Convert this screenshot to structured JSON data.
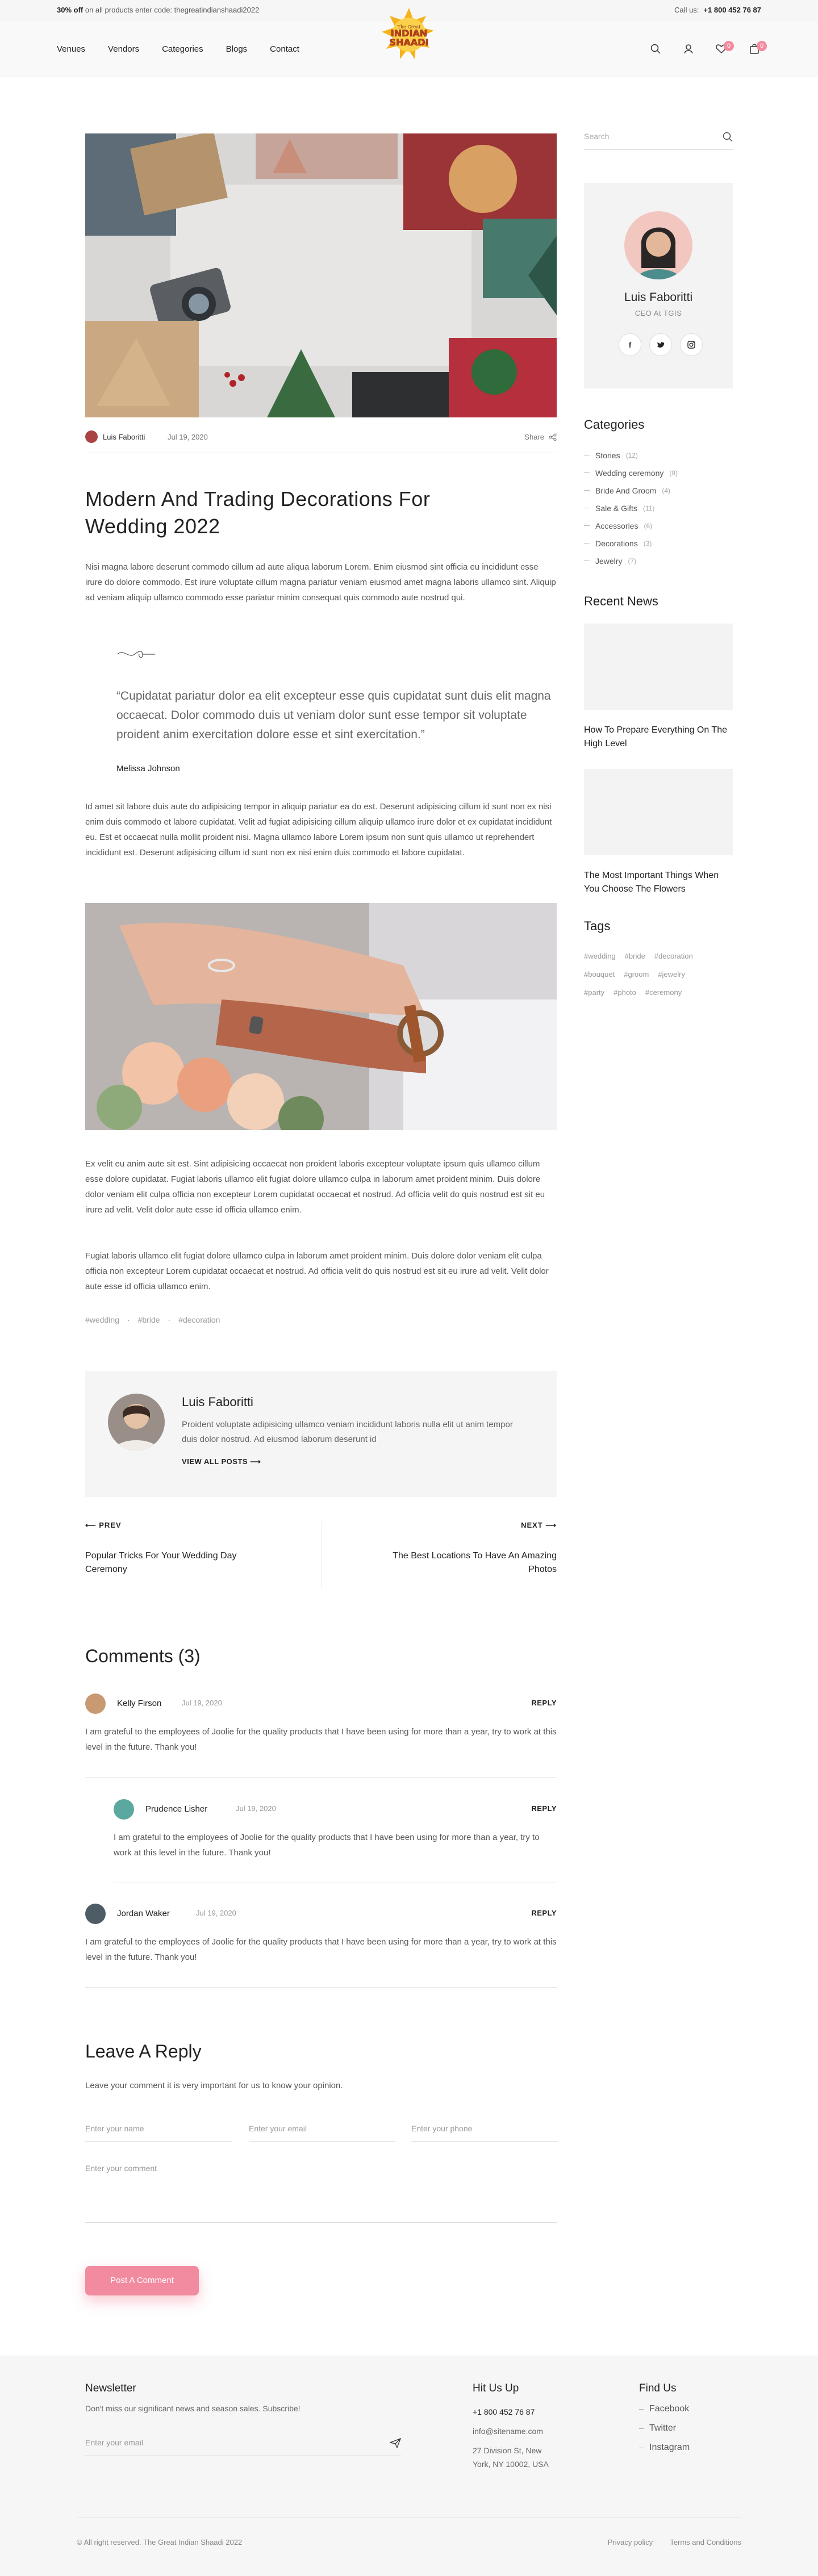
{
  "topbar": {
    "promo_bold": "30% off",
    "promo_text": "on all products enter code: thegreatindianshaadi2022",
    "call_label": "Call us:",
    "phone": "+1 800 452 76 87"
  },
  "logo": {
    "line1": "INDIAN",
    "line2": "SHAADI",
    "line3": "The Great"
  },
  "nav": [
    "Venues",
    "Vendors",
    "Categories",
    "Blogs",
    "Contact"
  ],
  "header_icons": {
    "wishlist_count": "0",
    "cart_count": "0"
  },
  "post": {
    "author": "Luis Faboritti",
    "date": "Jul 19, 2020",
    "share_label": "Share",
    "title": "Modern And Trading Decorations For Wedding 2022",
    "intro": "Nisi magna labore deserunt commodo cillum ad aute aliqua laborum Lorem. Enim eiusmod sint officia eu incididunt esse irure do dolore commodo. Est irure voluptate cillum magna pariatur veniam eiusmod amet magna laboris ullamco sint. Aliquip ad veniam aliquip ullamco commodo esse pariatur minim consequat quis commodo aute nostrud qui.",
    "quote": "“Cupidatat pariatur dolor ea elit excepteur esse quis cupidatat sunt duis elit magna occaecat. Dolor commodo duis ut veniam dolor sunt esse tempor sit voluptate  proident anim exercitation dolore esse et sint exercitation.”",
    "quote_author": "Melissa  Johnson",
    "para2": "Id amet sit labore duis aute do adipisicing tempor in aliquip pariatur ea do est. Deserunt adipisicing cillum id sunt non ex nisi enim duis commodo et labore cupidatat. Velit ad fugiat adipisicing cillum aliquip ullamco irure dolor et ex cupidatat incididunt eu. Est et occaecat nulla mollit proident nisi. Magna ullamco labore Lorem ipsum non sunt quis ullamco ut reprehendert incididunt est. Deserunt adipisicing cillum id sunt non ex nisi enim duis commodo et labore cupidatat.",
    "para3": "Ex velit eu anim aute sit est. Sint adipisicing occaecat non proident laboris excepteur voluptate ipsum quis ullamco cillum esse dolore cupidatat. Fugiat laboris ullamco elit fugiat dolore ullamco culpa in laborum amet proident minim. Duis dolore dolor veniam elit culpa officia non excepteur Lorem cupidatat occaecat et nostrud. Ad officia velit do quis nostrud est sit eu irure ad velit. Velit dolor aute esse id officia ullamco enim.",
    "para4": "Fugiat laboris ullamco elit fugiat dolore ullamco culpa in laborum amet proident minim. Duis dolore dolor veniam elit culpa officia non excepteur Lorem cupidatat occaecat et nostrud. Ad officia velit do quis nostrud est sit eu irure ad velit. Velit dolor aute esse id officia ullamco enim.",
    "tags": [
      "#wedding",
      "·",
      "#bride",
      "·",
      "#decoration"
    ]
  },
  "author_box": {
    "name": "Luis Faboritti",
    "bio": "Proident voluptate adipisicing ullamco veniam incididunt laboris nulla elit ut anim tempor duis dolor nostrud. Ad eiusmod laborum deserunt id",
    "view_all": "VIEW ALL POSTS"
  },
  "post_nav": {
    "prev_label": "PREV",
    "prev_title": "Popular Tricks For Your Wedding Day Ceremony",
    "next_label": "NEXT",
    "next_title": "The Best Locations To Have An Amazing Photos"
  },
  "comments": {
    "heading": "Comments (3)",
    "reply_label": "REPLY",
    "items": [
      {
        "name": "Kelly Firson",
        "date": "Jul 19, 2020",
        "text": "I am grateful to the employees of Joolie for the quality products that I have been using for more than a year, try to work at this level in the future. Thank you!"
      },
      {
        "name": "Prudence Lisher",
        "date": "Jul 19, 2020",
        "text": "I am grateful to the employees of Joolie for the quality products that I have been using for more than a year, try to work at this level in the future. Thank you!"
      },
      {
        "name": "Jordan Waker",
        "date": "Jul 19, 2020",
        "text": "I am grateful to the employees of Joolie for the quality products that I have been using for more than a year, try to work at this level in the future. Thank you!"
      }
    ]
  },
  "reply_form": {
    "heading": "Leave A Reply",
    "intro": "Leave your comment it is very important for us to know your opinion.",
    "name_placeholder": "Enter your name",
    "email_placeholder": "Enter your email",
    "phone_placeholder": "Enter your phone",
    "comment_placeholder": "Enter your comment",
    "submit": "Post A Comment"
  },
  "sidebar": {
    "search_placeholder": "Search",
    "profile_name": "Luis Faboritti",
    "profile_role": "CEO At TGIS",
    "categories_heading": "Categories",
    "categories": [
      {
        "name": "Stories",
        "count": "(12)"
      },
      {
        "name": "Wedding ceremony",
        "count": "(9)"
      },
      {
        "name": "Bride And Groom",
        "count": "(4)"
      },
      {
        "name": "Sale & Gifts",
        "count": "(11)"
      },
      {
        "name": "Accessories",
        "count": "(6)"
      },
      {
        "name": "Decorations",
        "count": "(3)"
      },
      {
        "name": "Jewelry",
        "count": "(7)"
      }
    ],
    "recent_heading": "Recent News",
    "recent": [
      {
        "title": "How To Prepare Everything On The High Level"
      },
      {
        "title": "The Most Important Things When You Choose The Flowers"
      }
    ],
    "tags_heading": "Tags",
    "tags": [
      "#wedding",
      "#bride",
      "#decoration",
      "#bouquet",
      "#groom",
      "#jewelry",
      "#party",
      "#photo",
      "#ceremony"
    ]
  },
  "footer": {
    "newsletter_heading": "Newsletter",
    "newsletter_text": "Don't miss our significant news and season sales. Subscribe!",
    "email_placeholder": "Enter your email",
    "hit_heading": "Hit Us Up",
    "phone": "+1 800 452 76 87",
    "email": "info@sitename.com",
    "address1": "27 Division St, New",
    "address2": "York, NY 10002, USA",
    "find_heading": "Find Us",
    "social": [
      "Facebook",
      "Twitter",
      "Instagram"
    ],
    "copyright": "© All right reserved. The Great Indian Shaadi 2022",
    "privacy": "Privacy policy",
    "terms": "Terms and Conditions"
  }
}
